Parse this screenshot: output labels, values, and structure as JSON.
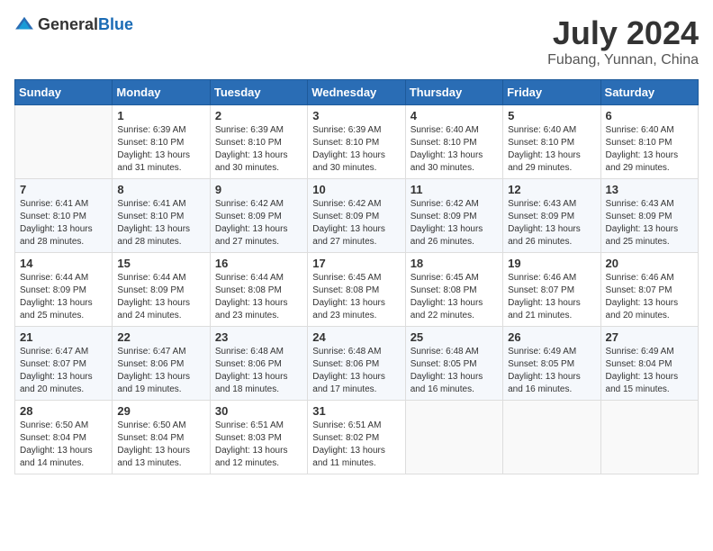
{
  "header": {
    "logo_general": "General",
    "logo_blue": "Blue",
    "month_title": "July 2024",
    "location": "Fubang, Yunnan, China"
  },
  "calendar": {
    "days_of_week": [
      "Sunday",
      "Monday",
      "Tuesday",
      "Wednesday",
      "Thursday",
      "Friday",
      "Saturday"
    ],
    "weeks": [
      [
        {
          "day": "",
          "info": ""
        },
        {
          "day": "1",
          "info": "Sunrise: 6:39 AM\nSunset: 8:10 PM\nDaylight: 13 hours\nand 31 minutes."
        },
        {
          "day": "2",
          "info": "Sunrise: 6:39 AM\nSunset: 8:10 PM\nDaylight: 13 hours\nand 30 minutes."
        },
        {
          "day": "3",
          "info": "Sunrise: 6:39 AM\nSunset: 8:10 PM\nDaylight: 13 hours\nand 30 minutes."
        },
        {
          "day": "4",
          "info": "Sunrise: 6:40 AM\nSunset: 8:10 PM\nDaylight: 13 hours\nand 30 minutes."
        },
        {
          "day": "5",
          "info": "Sunrise: 6:40 AM\nSunset: 8:10 PM\nDaylight: 13 hours\nand 29 minutes."
        },
        {
          "day": "6",
          "info": "Sunrise: 6:40 AM\nSunset: 8:10 PM\nDaylight: 13 hours\nand 29 minutes."
        }
      ],
      [
        {
          "day": "7",
          "info": "Sunrise: 6:41 AM\nSunset: 8:10 PM\nDaylight: 13 hours\nand 28 minutes."
        },
        {
          "day": "8",
          "info": "Sunrise: 6:41 AM\nSunset: 8:10 PM\nDaylight: 13 hours\nand 28 minutes."
        },
        {
          "day": "9",
          "info": "Sunrise: 6:42 AM\nSunset: 8:09 PM\nDaylight: 13 hours\nand 27 minutes."
        },
        {
          "day": "10",
          "info": "Sunrise: 6:42 AM\nSunset: 8:09 PM\nDaylight: 13 hours\nand 27 minutes."
        },
        {
          "day": "11",
          "info": "Sunrise: 6:42 AM\nSunset: 8:09 PM\nDaylight: 13 hours\nand 26 minutes."
        },
        {
          "day": "12",
          "info": "Sunrise: 6:43 AM\nSunset: 8:09 PM\nDaylight: 13 hours\nand 26 minutes."
        },
        {
          "day": "13",
          "info": "Sunrise: 6:43 AM\nSunset: 8:09 PM\nDaylight: 13 hours\nand 25 minutes."
        }
      ],
      [
        {
          "day": "14",
          "info": "Sunrise: 6:44 AM\nSunset: 8:09 PM\nDaylight: 13 hours\nand 25 minutes."
        },
        {
          "day": "15",
          "info": "Sunrise: 6:44 AM\nSunset: 8:09 PM\nDaylight: 13 hours\nand 24 minutes."
        },
        {
          "day": "16",
          "info": "Sunrise: 6:44 AM\nSunset: 8:08 PM\nDaylight: 13 hours\nand 23 minutes."
        },
        {
          "day": "17",
          "info": "Sunrise: 6:45 AM\nSunset: 8:08 PM\nDaylight: 13 hours\nand 23 minutes."
        },
        {
          "day": "18",
          "info": "Sunrise: 6:45 AM\nSunset: 8:08 PM\nDaylight: 13 hours\nand 22 minutes."
        },
        {
          "day": "19",
          "info": "Sunrise: 6:46 AM\nSunset: 8:07 PM\nDaylight: 13 hours\nand 21 minutes."
        },
        {
          "day": "20",
          "info": "Sunrise: 6:46 AM\nSunset: 8:07 PM\nDaylight: 13 hours\nand 20 minutes."
        }
      ],
      [
        {
          "day": "21",
          "info": "Sunrise: 6:47 AM\nSunset: 8:07 PM\nDaylight: 13 hours\nand 20 minutes."
        },
        {
          "day": "22",
          "info": "Sunrise: 6:47 AM\nSunset: 8:06 PM\nDaylight: 13 hours\nand 19 minutes."
        },
        {
          "day": "23",
          "info": "Sunrise: 6:48 AM\nSunset: 8:06 PM\nDaylight: 13 hours\nand 18 minutes."
        },
        {
          "day": "24",
          "info": "Sunrise: 6:48 AM\nSunset: 8:06 PM\nDaylight: 13 hours\nand 17 minutes."
        },
        {
          "day": "25",
          "info": "Sunrise: 6:48 AM\nSunset: 8:05 PM\nDaylight: 13 hours\nand 16 minutes."
        },
        {
          "day": "26",
          "info": "Sunrise: 6:49 AM\nSunset: 8:05 PM\nDaylight: 13 hours\nand 16 minutes."
        },
        {
          "day": "27",
          "info": "Sunrise: 6:49 AM\nSunset: 8:04 PM\nDaylight: 13 hours\nand 15 minutes."
        }
      ],
      [
        {
          "day": "28",
          "info": "Sunrise: 6:50 AM\nSunset: 8:04 PM\nDaylight: 13 hours\nand 14 minutes."
        },
        {
          "day": "29",
          "info": "Sunrise: 6:50 AM\nSunset: 8:04 PM\nDaylight: 13 hours\nand 13 minutes."
        },
        {
          "day": "30",
          "info": "Sunrise: 6:51 AM\nSunset: 8:03 PM\nDaylight: 13 hours\nand 12 minutes."
        },
        {
          "day": "31",
          "info": "Sunrise: 6:51 AM\nSunset: 8:02 PM\nDaylight: 13 hours\nand 11 minutes."
        },
        {
          "day": "",
          "info": ""
        },
        {
          "day": "",
          "info": ""
        },
        {
          "day": "",
          "info": ""
        }
      ]
    ]
  }
}
